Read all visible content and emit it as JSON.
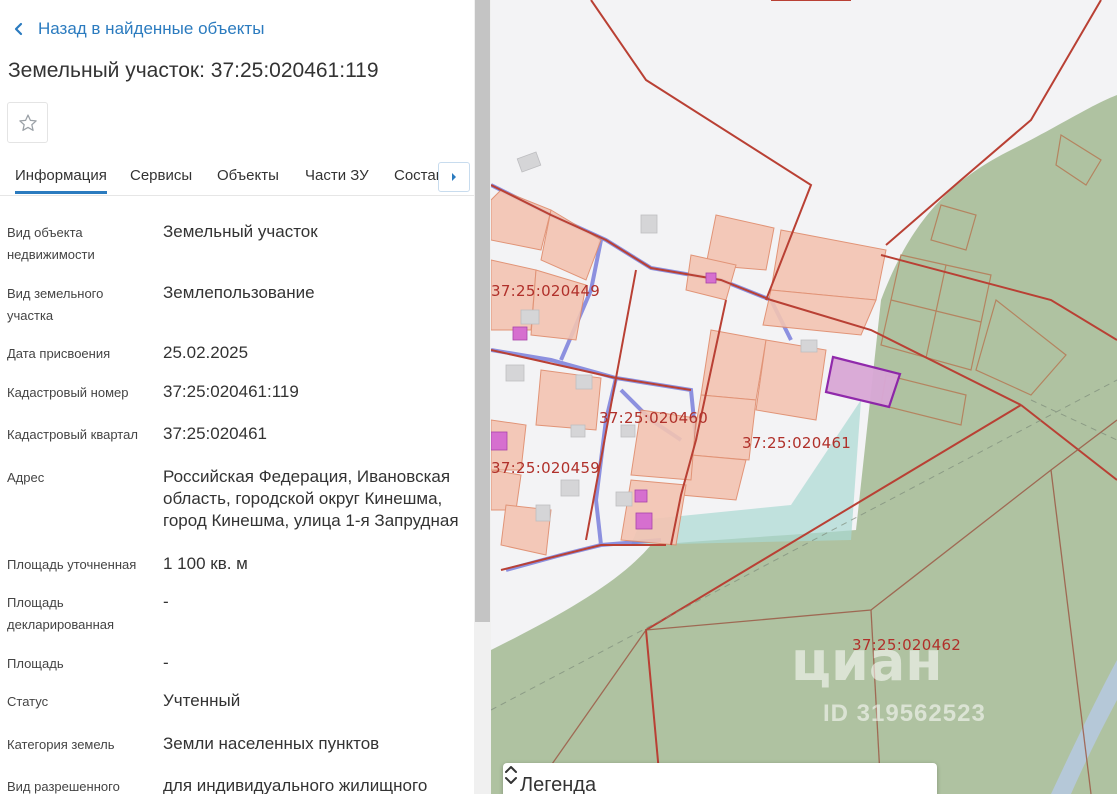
{
  "nav": {
    "back_label": "Назад в найденные объекты"
  },
  "object": {
    "title": "Земельный участок: 37:25:020461:119"
  },
  "tabs": [
    {
      "label": "Информация",
      "active": true
    },
    {
      "label": "Сервисы"
    },
    {
      "label": "Объекты"
    },
    {
      "label": "Части ЗУ"
    },
    {
      "label": "Состав"
    }
  ],
  "icons": {
    "back": "chevron-left-icon",
    "favorite": "star-outline-icon",
    "tab_scroll": "arrow-right-icon",
    "legend_toggle": "chevron-up-down-icon"
  },
  "info": [
    {
      "label": "Вид объекта недвижимости",
      "value": "Земельный участок"
    },
    {
      "label": "Вид земельного участка",
      "value": "Землепользование"
    },
    {
      "label": "Дата присвоения",
      "value": "25.02.2025"
    },
    {
      "label": "Кадастровый номер",
      "value": "37:25:020461:119"
    },
    {
      "label": "Кадастровый квартал",
      "value": "37:25:020461"
    },
    {
      "label": "Адрес",
      "value": "Российская Федерация, Ивановская область, городской округ Кинешма, город Кинешма, улица 1-я Запрудная"
    },
    {
      "label": "Площадь уточненная",
      "value": "1 100 кв. м"
    },
    {
      "label": "Площадь декларированная",
      "value": "-"
    },
    {
      "label": "Площадь",
      "value": "-"
    },
    {
      "label": "Статус",
      "value": "Учтенный"
    },
    {
      "label": "Категория земель",
      "value": "Земли населенных пунктов"
    },
    {
      "label": "Вид разрешенного",
      "value": "для индивидуального жилищного"
    }
  ],
  "map": {
    "labels": [
      "37:25:020449",
      "37:25:020460",
      "37:25:020461",
      "37:25:020459",
      "37:25:020462"
    ],
    "watermark": {
      "brand": "циан",
      "id": "ID 319562523"
    },
    "legend_title": "Легенда"
  },
  "colors": {
    "accent": "#2b7bbf",
    "boundary": "#b94034",
    "parcel_fill": "#f3c4b2",
    "selected_parcel": "#8b1fa8",
    "forest": "#a7bd98",
    "water": "#a9d8d3"
  }
}
